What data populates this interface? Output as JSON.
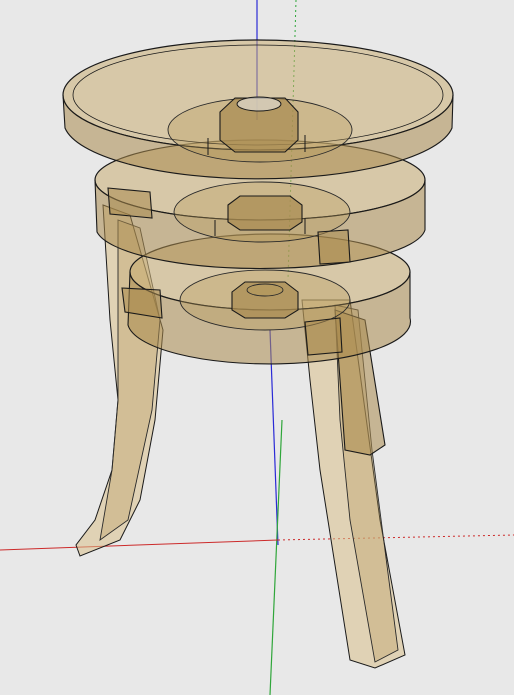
{
  "viewport": {
    "background": "#e8e8e8",
    "axis_colors": {
      "red_axis": "#cc2a2a",
      "green_axis": "#2fa63a",
      "blue_axis": "#2a2ad6"
    },
    "model": {
      "material_color": "#c8ad73",
      "transparency": "x-ray"
    }
  }
}
